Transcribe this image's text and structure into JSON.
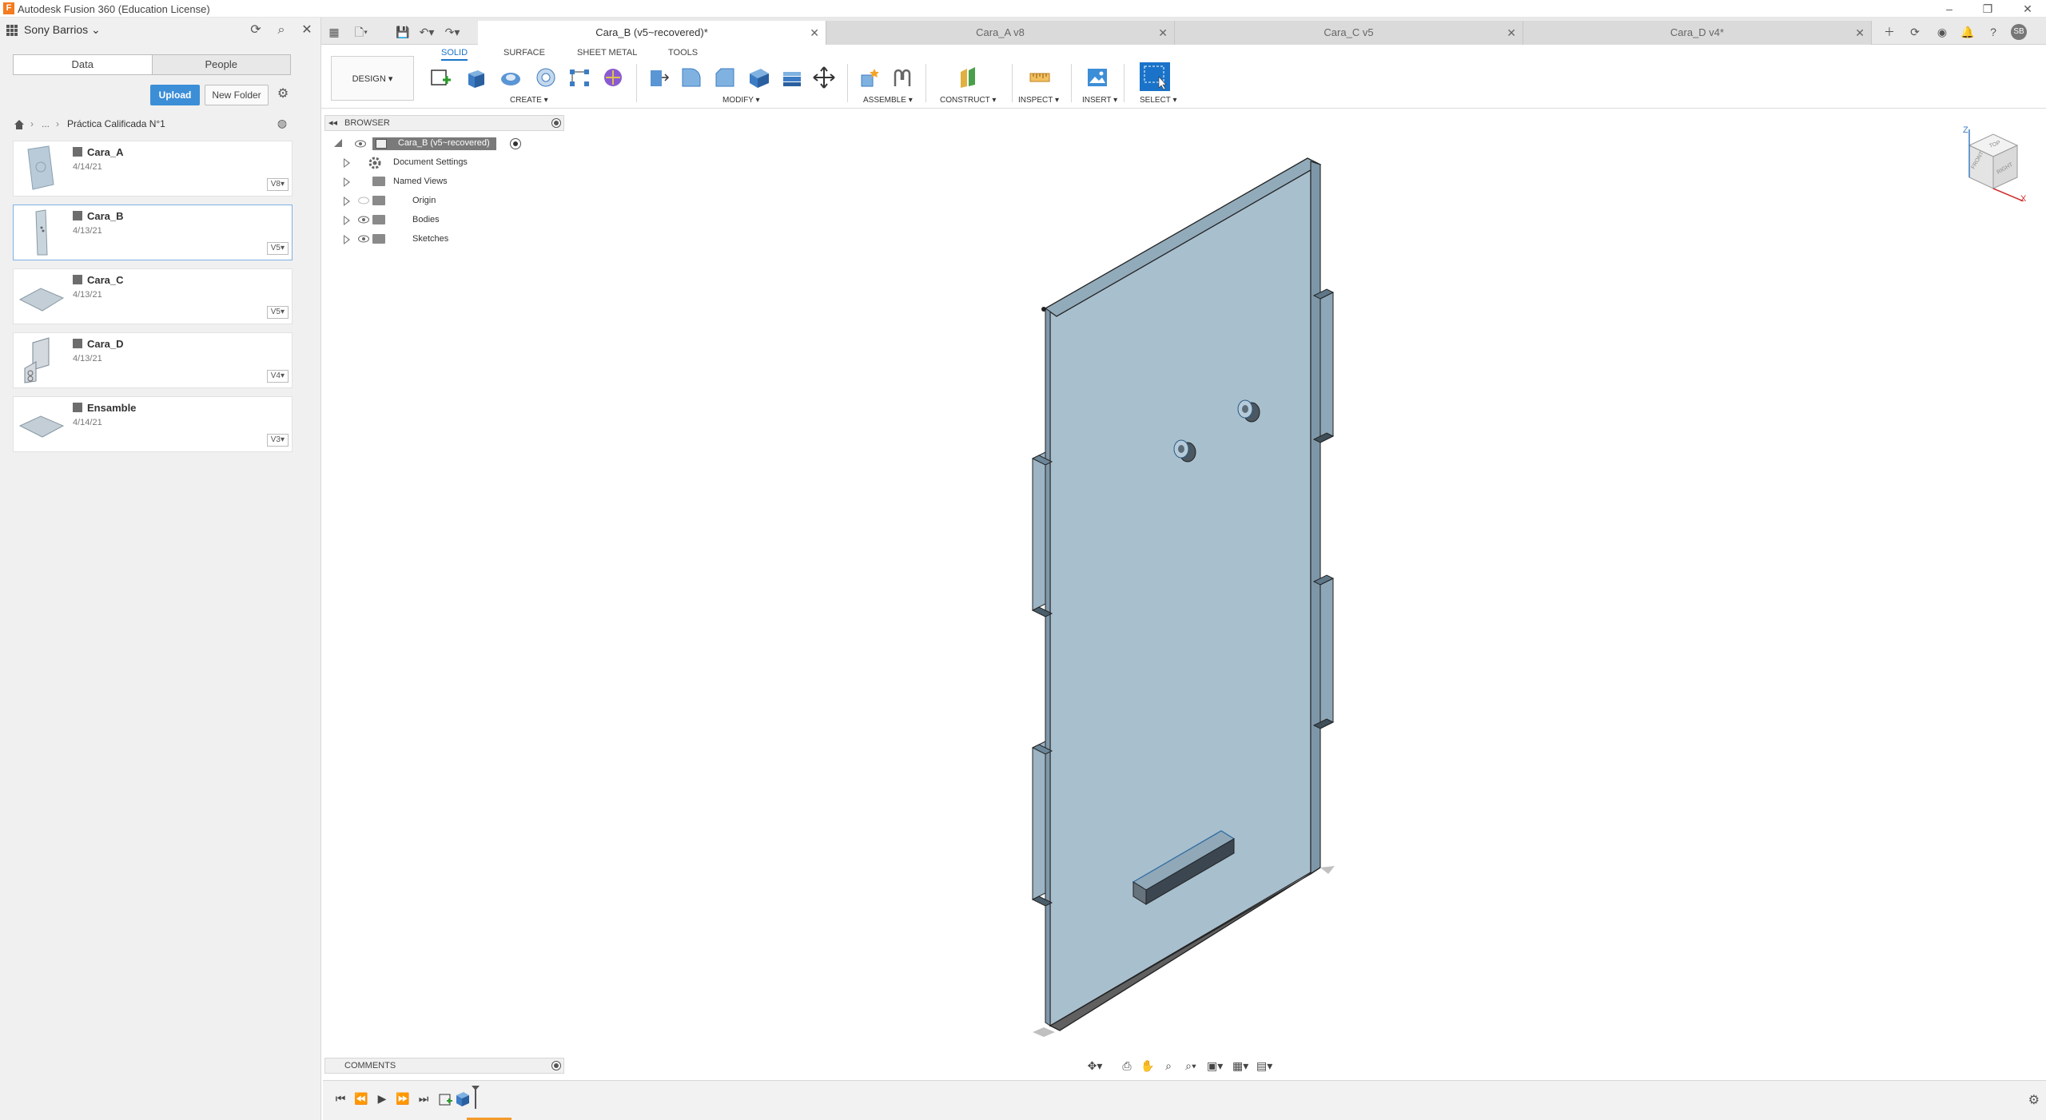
{
  "window": {
    "title": "Autodesk Fusion 360 (Education License)",
    "logo_letter": "F",
    "controls": [
      "minimize-icon",
      "restore-icon",
      "close-icon"
    ]
  },
  "data_panel": {
    "user": "Sony Barrios",
    "tabs": [
      "Data",
      "People"
    ],
    "active_tab": "Data",
    "upload_label": "Upload",
    "new_folder_label": "New Folder",
    "breadcrumb": {
      "ellipsis": "...",
      "folder": "Práctica Calificada N°1"
    },
    "files": [
      {
        "name": "Cara_A",
        "date": "4/14/21",
        "version": "V8"
      },
      {
        "name": "Cara_B",
        "date": "4/13/21",
        "version": "V5",
        "selected": true
      },
      {
        "name": "Cara_C",
        "date": "4/13/21",
        "version": "V5"
      },
      {
        "name": "Cara_D",
        "date": "4/13/21",
        "version": "V4"
      },
      {
        "name": "Ensamble",
        "date": "4/14/21",
        "version": "V3"
      }
    ]
  },
  "doc_tabs": [
    {
      "label": "Cara_B (v5~recovered)*",
      "active": true
    },
    {
      "label": "Cara_A v8",
      "active": false
    },
    {
      "label": "Cara_C v5",
      "active": false
    },
    {
      "label": "Cara_D v4*",
      "active": false
    }
  ],
  "ribbon": {
    "workspace": "DESIGN",
    "tabs": [
      "SOLID",
      "SURFACE",
      "SHEET METAL",
      "TOOLS"
    ],
    "active_tab": "SOLID",
    "groups": [
      "CREATE",
      "MODIFY",
      "ASSEMBLE",
      "CONSTRUCT",
      "INSPECT",
      "INSERT",
      "SELECT"
    ]
  },
  "browser": {
    "title": "BROWSER",
    "root": "Cara_B (v5~recovered)",
    "items": [
      "Document Settings",
      "Named Views",
      "Origin",
      "Bodies",
      "Sketches"
    ]
  },
  "comments": {
    "title": "COMMENTS"
  },
  "viewcube": {
    "top": "TOP",
    "front": "FRONT",
    "right": "RIGHT",
    "z_axis": "Z",
    "x_axis": "X"
  },
  "colors": {
    "accent": "#3c8ed6",
    "body_fill": "#a9c0cf",
    "body_edge": "#2b2b2b",
    "timeline_marker": "#f39a2a"
  }
}
